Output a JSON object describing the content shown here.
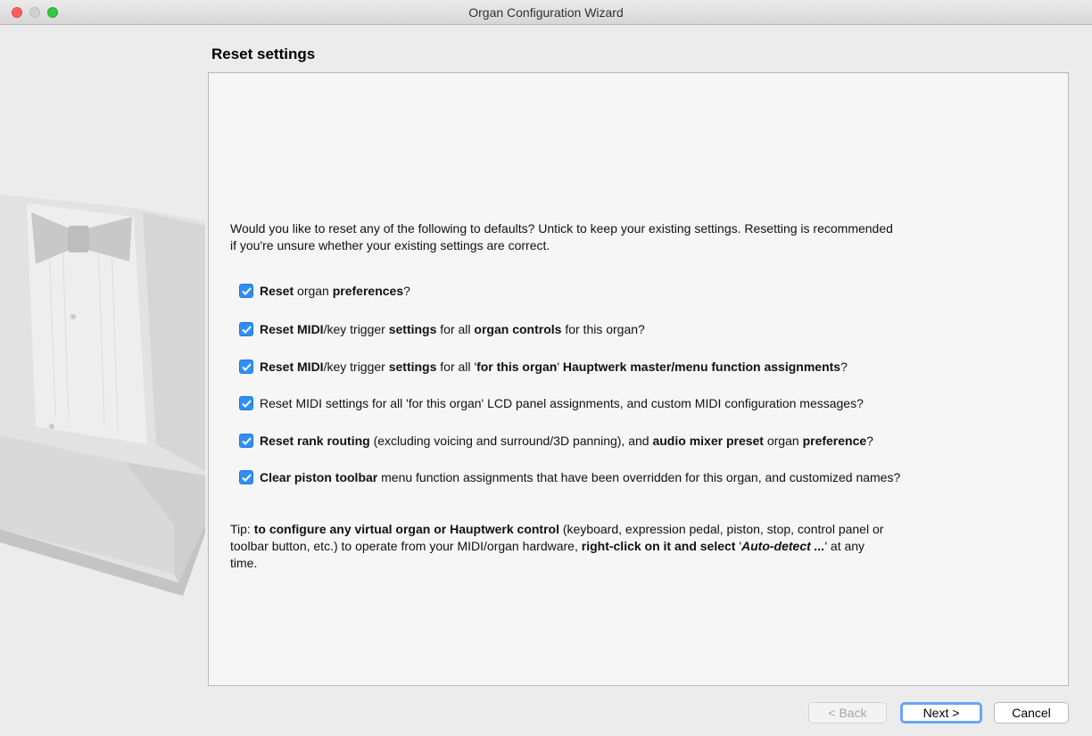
{
  "window": {
    "title": "Organ Configuration Wizard"
  },
  "page": {
    "heading": "Reset settings"
  },
  "intro": {
    "line1": "Would you like to reset any of the following to defaults? Untick to keep your existing settings. Resetting is recommended",
    "line2": "if you're unsure whether your existing settings are correct."
  },
  "options": [
    {
      "checked": true,
      "parts": [
        "Reset",
        " organ ",
        "preferences",
        "?"
      ]
    },
    {
      "checked": true,
      "parts": [
        "Reset MIDI",
        "/key trigger ",
        "settings",
        " for all ",
        "organ controls",
        " for this organ?"
      ]
    },
    {
      "checked": true,
      "parts": [
        "Reset MIDI",
        "/key trigger ",
        "settings",
        " for all '",
        "for this organ",
        "' ",
        "Hauptwerk master/menu function assignments",
        "?"
      ]
    },
    {
      "checked": true,
      "parts": [
        "Reset MIDI settings for all 'for this organ' LCD panel assignments, and custom MIDI configuration messages?"
      ]
    },
    {
      "checked": true,
      "parts": [
        "Reset rank routing",
        " (excluding voicing and surround/3D panning), and ",
        "audio mixer preset",
        " organ ",
        "preference",
        "?"
      ]
    },
    {
      "checked": true,
      "parts": [
        "Clear piston toolbar",
        " menu function assignments that have been overridden for this organ, and customized names?"
      ]
    }
  ],
  "tip": {
    "p1": "Tip: ",
    "p2": "to configure any virtual organ or Hauptwerk control",
    "p3": " (keyboard, expression pedal, piston, stop, control panel or",
    "p4": "toolbar button, etc.) to operate from your MIDI/organ hardware, ",
    "p5": "right-click on it and select",
    "p6": " '",
    "p7": "Auto-detect ...",
    "p8": "' at any",
    "p9": "time."
  },
  "buttons": {
    "back": "< Back",
    "next": "Next >",
    "cancel": "Cancel"
  },
  "colors": {
    "accent": "#2f8ff5",
    "default_button_ring": "#6aa6f0"
  },
  "icons": {
    "sidebar_art": "tuxedo-bowtie-illustration",
    "checkbox": "checkmark-icon"
  }
}
